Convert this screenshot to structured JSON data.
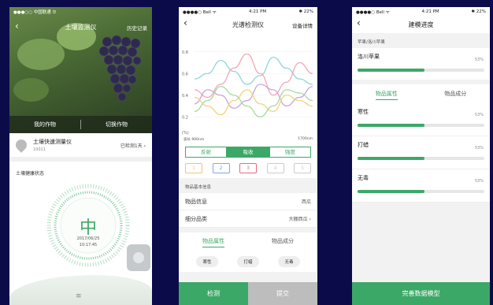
{
  "screen1": {
    "status": {
      "carrier": "●●●○○ 中国联通 ☰",
      "time": "",
      "battery": ""
    },
    "title": "土壤监测仪",
    "history_label": "历史记录",
    "tabs": [
      "我的作物",
      "切换作物"
    ],
    "device": {
      "name": "土壤快速测量仪",
      "id": "10011",
      "status": "已检测1天"
    },
    "section_label": "土壤健康状态",
    "gauge": {
      "level": "中",
      "date": "2017/06/25",
      "time": "10:17:45"
    },
    "accent": "#3ca867"
  },
  "screen2": {
    "status": {
      "carrier": "●●●●○ Bell ᯤ",
      "time": "4:21 PM",
      "battery": "✱ 22%"
    },
    "title": "光谱检测仪",
    "detail_label": "设备详情",
    "chart_data": {
      "type": "line",
      "yticks": [
        "0.8",
        "0.6",
        "0.4",
        "0.2"
      ],
      "yunit": "(%)",
      "x_start_label": "波长 900nm",
      "x_end_label": "1700nm",
      "series": [
        {
          "color": "#8fd5d8",
          "values": [
            0.55,
            0.6,
            0.72,
            0.62,
            0.5,
            0.58,
            0.75,
            0.65,
            0.55,
            0.5
          ]
        },
        {
          "color": "#f2a6b8",
          "values": [
            0.45,
            0.38,
            0.5,
            0.65,
            0.78,
            0.6,
            0.4,
            0.52,
            0.7,
            0.6
          ]
        },
        {
          "color": "#c9a3e0",
          "values": [
            0.32,
            0.45,
            0.4,
            0.28,
            0.35,
            0.5,
            0.45,
            0.3,
            0.38,
            0.48
          ]
        },
        {
          "color": "#f4d27a",
          "values": [
            0.38,
            0.3,
            0.22,
            0.35,
            0.45,
            0.32,
            0.25,
            0.4,
            0.35,
            0.3
          ]
        },
        {
          "color": "#a8d8a0",
          "values": [
            0.25,
            0.35,
            0.48,
            0.4,
            0.3,
            0.2,
            0.3,
            0.45,
            0.42,
            0.35
          ]
        }
      ]
    },
    "segments": [
      "反射",
      "吸收",
      "强度"
    ],
    "selected_segment": 1,
    "chips": [
      {
        "label": "1",
        "color": "#f4c27a"
      },
      {
        "label": "2",
        "color": "#7fa6e8"
      },
      {
        "label": "3",
        "color": "#e86a7a"
      },
      {
        "label": "4",
        "color": "#cccccc"
      },
      {
        "label": "5",
        "color": "#cccccc"
      }
    ],
    "section_label": "物品基本信息",
    "rows": [
      {
        "label": "物品信息",
        "value": "西瓜"
      },
      {
        "label": "细分品类",
        "value": "大棚西瓜"
      }
    ],
    "prop_tabs": [
      "物品属性",
      "物品成分"
    ],
    "tags": [
      "寒性",
      "打蜡",
      "无毒"
    ],
    "buttons": {
      "detect": "检测",
      "submit": "提交"
    }
  },
  "screen3": {
    "status": {
      "carrier": "●●●●○ Bell ᯤ",
      "time": "4:21 PM",
      "battery": "✱ 22%"
    },
    "title": "建模进度",
    "breadcrumb": "苹果/洛川苹果",
    "product": {
      "label": "洛川苹果",
      "percent_text": "53%",
      "progress": 0.53
    },
    "prop_tabs": [
      "物品属性",
      "物品成分"
    ],
    "attributes": [
      {
        "label": "寒性",
        "percent_text": "53%",
        "progress": 0.53
      },
      {
        "label": "打蜡",
        "percent_text": "53%",
        "progress": 0.53
      },
      {
        "label": "无毒",
        "percent_text": "53%",
        "progress": 0.53
      }
    ],
    "button": "完善数据模型"
  }
}
